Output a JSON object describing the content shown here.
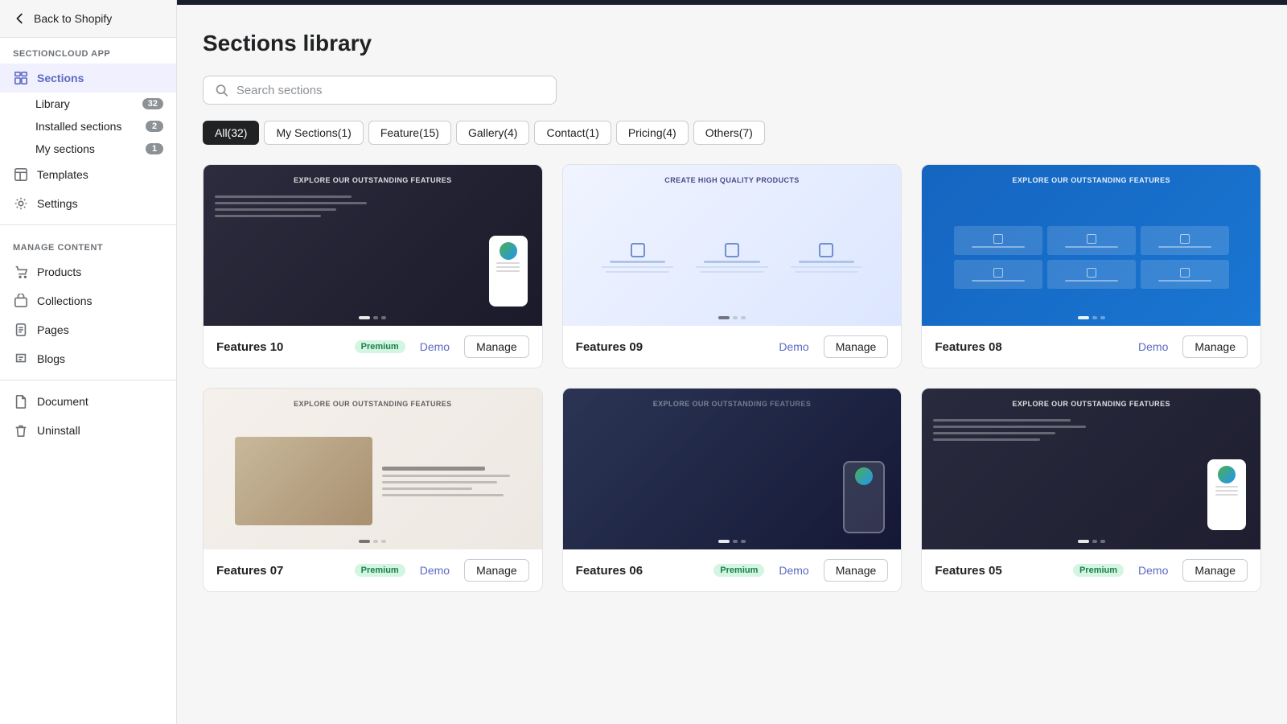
{
  "app": {
    "name": "SECTIONCLOUD APP",
    "back_label": "Back to Shopify"
  },
  "sidebar": {
    "sections_label": "Sections",
    "library_label": "Library",
    "library_count": "32",
    "installed_label": "Installed sections",
    "installed_count": "2",
    "my_sections_label": "My sections",
    "my_sections_count": "1",
    "templates_label": "Templates",
    "settings_label": "Settings",
    "manage_content_label": "MANAGE CONTENT",
    "products_label": "Products",
    "collections_label": "Collections",
    "pages_label": "Pages",
    "blogs_label": "Blogs",
    "document_label": "Document",
    "uninstall_label": "Uninstall"
  },
  "main": {
    "title": "Sections library",
    "search_placeholder": "Search sections",
    "filter_tabs": [
      {
        "id": "all",
        "label": "All(32)",
        "active": true
      },
      {
        "id": "my",
        "label": "My Sections(1)",
        "active": false
      },
      {
        "id": "feature",
        "label": "Feature(15)",
        "active": false
      },
      {
        "id": "gallery",
        "label": "Gallery(4)",
        "active": false
      },
      {
        "id": "contact",
        "label": "Contact(1)",
        "active": false
      },
      {
        "id": "pricing",
        "label": "Pricing(4)",
        "active": false
      },
      {
        "id": "others",
        "label": "Others(7)",
        "active": false
      }
    ],
    "cards": [
      {
        "id": "features10",
        "name": "Features 10",
        "badge": "Premium",
        "demo_label": "Demo",
        "manage_label": "Manage",
        "thumb_style": "dark"
      },
      {
        "id": "features09",
        "name": "Features 09",
        "badge": "",
        "demo_label": "Demo",
        "manage_label": "Manage",
        "thumb_style": "light"
      },
      {
        "id": "features08",
        "name": "Features 08",
        "badge": "",
        "demo_label": "Demo",
        "manage_label": "Manage",
        "thumb_style": "blue"
      },
      {
        "id": "features07",
        "name": "Features 07",
        "badge": "Premium",
        "demo_label": "Demo",
        "manage_label": "Manage",
        "thumb_style": "cream"
      },
      {
        "id": "features06",
        "name": "Features 06",
        "badge": "Premium",
        "demo_label": "Demo",
        "manage_label": "Manage",
        "thumb_style": "dark"
      },
      {
        "id": "features05",
        "name": "Features 05",
        "badge": "Premium",
        "demo_label": "Demo",
        "manage_label": "Manage",
        "thumb_style": "dark2"
      }
    ]
  },
  "colors": {
    "accent": "#5c6ac4",
    "premium_bg": "#d3f5e2",
    "premium_text": "#1a7f4b"
  }
}
